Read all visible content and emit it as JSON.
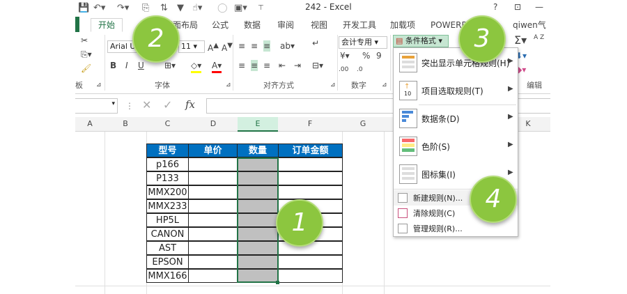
{
  "title": "242 - Excel",
  "window_buttons": {
    "help": "?",
    "restore": "⊡",
    "minimize": "—"
  },
  "tabs": {
    "home": "开始",
    "page_layout": "页面布局",
    "formulas": "公式",
    "data": "数据",
    "review": "审阅",
    "view": "视图",
    "developer": "开发工具",
    "addins": "加载项",
    "powerpivot": "POWERPI",
    "user": "qiwen气温"
  },
  "ribbon": {
    "font_name": "Arial U",
    "font_size": "11",
    "bold": "B",
    "italic": "I",
    "underline": "U",
    "number_format": "会计专用",
    "percent": "%",
    "comma": "9",
    "currency": "¥",
    "cond_format": "条件格式",
    "sigma": "Σ",
    "sort": "A Z",
    "group_clipboard": "板",
    "group_font": "字体",
    "group_align": "对齐方式",
    "group_number": "数字",
    "group_edit": "编辑",
    "inc_decimal": ".00",
    "dec_decimal": ".0"
  },
  "formula_bar": {
    "fx": "fx",
    "cancel": "✕",
    "enter": "✓"
  },
  "columns": [
    "A",
    "B",
    "C",
    "D",
    "E",
    "F",
    "G",
    "K"
  ],
  "table": {
    "headers": [
      "型号",
      "单价",
      "数量",
      "订单金额"
    ],
    "models": [
      "p166",
      "P133",
      "MMX200",
      "MMX233",
      "HP5L",
      "CANON",
      "AST",
      "EPSON",
      "MMX166"
    ]
  },
  "menu": {
    "highlight_rules": "突出显示单元格规则(H)",
    "top_bottom": "项目选取规则(T)",
    "top_icon_num": "10",
    "data_bars": "数据条(D)",
    "color_scales": "色阶(S)",
    "icon_sets": "图标集(I)",
    "new_rule": "新建规则(N)...",
    "clear_rules": "清除规则(C)",
    "manage_rules": "管理规则(R)..."
  },
  "badges": [
    "1",
    "2",
    "3",
    "4"
  ],
  "colors": {
    "excel_green": "#217346",
    "header_blue": "#0070c0",
    "badge_green": "#8cc63f",
    "selected_gray": "#c0c0c0"
  }
}
